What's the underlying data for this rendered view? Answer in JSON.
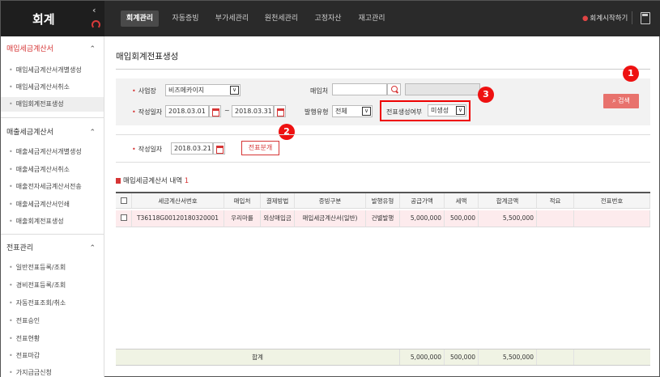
{
  "app": {
    "title": "회계",
    "start_label": "회계시작하기"
  },
  "top_tabs": [
    "회계관리",
    "자동증빙",
    "부가세관리",
    "원천세관리",
    "고정자산",
    "재고관리"
  ],
  "sidebar": {
    "sections": [
      {
        "title": "매입세금계산서",
        "items": [
          "매입세금계산서개별생성",
          "매입세금계산서취소",
          "매입회계전표생성"
        ]
      },
      {
        "title": "매출세금계산서",
        "items": [
          "매출세금계산서개별생성",
          "매출세금계산서취소",
          "매출전자세금계산서전송",
          "매출세금계산서인쇄",
          "매출회계전표생성"
        ]
      },
      {
        "title": "전표관리",
        "items": [
          "일반전표등록/조회",
          "경비전표등록/조회",
          "자동전표조회/취소",
          "전표승인",
          "전표현황",
          "전표마감",
          "가지급금신청"
        ]
      }
    ]
  },
  "page": {
    "title": "매입회계전표생성"
  },
  "filter": {
    "workplace_label": "사업장",
    "workplace_value": "비즈메카이지",
    "vendor_label": "매입처",
    "vendor_value": "",
    "date_label": "작성일자",
    "date_from": "2018.03.01",
    "date_sep": "~",
    "date_to": "2018.03.31",
    "issue_type_label": "발행유형",
    "issue_type_value": "전체",
    "voucher_status_label": "전표생성여부",
    "voucher_status_value": "미생성",
    "search_label": "검색"
  },
  "split": {
    "date_label": "작성일자",
    "date_value": "2018.03.21",
    "button_label": "전표분개"
  },
  "callouts": [
    "1",
    "2",
    "3"
  ],
  "section": {
    "title": "매입세금계산서 내역",
    "count": "1"
  },
  "table": {
    "headers": [
      "세금계산서번호",
      "매입처",
      "결제방법",
      "증빙구분",
      "발행유형",
      "공급가액",
      "세액",
      "합계금액",
      "적요",
      "전표번호"
    ],
    "rows": [
      [
        "T36118G00120180320001",
        "우리마를",
        "외상매입금",
        "매입세금계산서(일반)",
        "건별발행",
        "5,000,000",
        "500,000",
        "5,500,000",
        "",
        ""
      ]
    ],
    "total": {
      "label": "합계",
      "supply": "5,000,000",
      "tax": "500,000",
      "sum": "5,500,000"
    }
  }
}
